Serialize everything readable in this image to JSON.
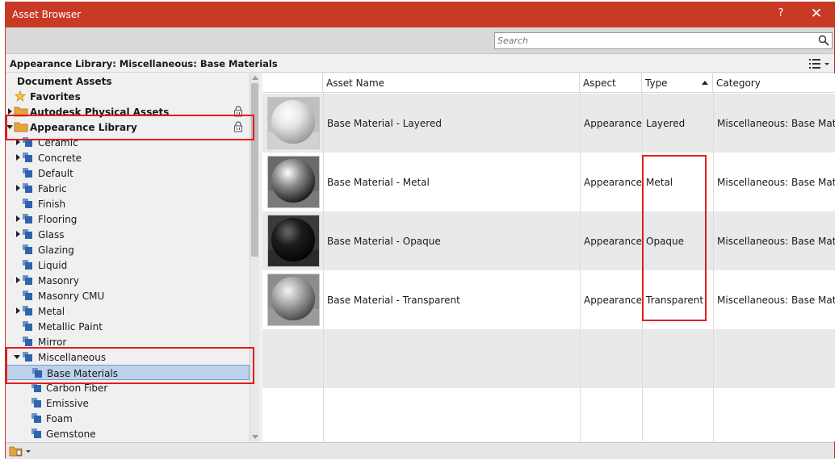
{
  "window": {
    "title": "Asset Browser",
    "help_label": "?",
    "close_label": "✕"
  },
  "search": {
    "placeholder": "Search",
    "value": ""
  },
  "path": {
    "text": "Appearance Library: Miscellaneous: Base Materials"
  },
  "tree": {
    "document_assets": "Document Assets",
    "favorites": "Favorites",
    "autodesk_physical": "Autodesk Physical Assets",
    "appearance_library": "Appearance Library",
    "categories": [
      {
        "label": "Ceramic",
        "expandable": true
      },
      {
        "label": "Concrete",
        "expandable": true
      },
      {
        "label": "Default",
        "expandable": false
      },
      {
        "label": "Fabric",
        "expandable": true
      },
      {
        "label": "Finish",
        "expandable": false
      },
      {
        "label": "Flooring",
        "expandable": true
      },
      {
        "label": "Glass",
        "expandable": true
      },
      {
        "label": "Glazing",
        "expandable": false
      },
      {
        "label": "Liquid",
        "expandable": false
      },
      {
        "label": "Masonry",
        "expandable": true
      },
      {
        "label": "Masonry CMU",
        "expandable": false
      },
      {
        "label": "Metal",
        "expandable": true
      },
      {
        "label": "Metallic Paint",
        "expandable": false
      },
      {
        "label": "Mirror",
        "expandable": false
      },
      {
        "label": "Miscellaneous",
        "expandable": true
      }
    ],
    "misc_children": [
      {
        "label": "Base Materials",
        "selected": true
      },
      {
        "label": "Carbon Fiber",
        "selected": false
      },
      {
        "label": "Emissive",
        "selected": false
      },
      {
        "label": "Foam",
        "selected": false
      },
      {
        "label": "Gemstone",
        "selected": false
      }
    ]
  },
  "table": {
    "columns": [
      "",
      "Asset Name",
      "Aspect",
      "Type",
      "Category"
    ],
    "sort_column": "Type",
    "rows": [
      {
        "name": "Base Material - Layered",
        "aspect": "Appearance",
        "type": "Layered",
        "category": "Miscellaneous: Base Materials",
        "sphere": "white"
      },
      {
        "name": "Base Material - Metal",
        "aspect": "Appearance",
        "type": "Metal",
        "category": "Miscellaneous: Base Materials",
        "sphere": "chrome"
      },
      {
        "name": "Base Material - Opaque",
        "aspect": "Appearance",
        "type": "Opaque",
        "category": "Miscellaneous: Base Materials",
        "sphere": "black"
      },
      {
        "name": "Base Material - Transparent",
        "aspect": "Appearance",
        "type": "Transparent",
        "category": "Miscellaneous: Base Materials",
        "sphere": "glass"
      }
    ]
  },
  "colors": {
    "titlebar": "#c93a24",
    "selection": "#bcd1ea",
    "highlight_box": "#e01e1e",
    "folder": "#e8a33d",
    "category_icon": "#3b6fb6"
  }
}
